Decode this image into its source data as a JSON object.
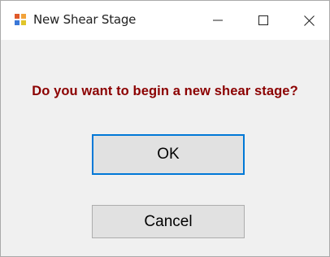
{
  "window": {
    "title": "New Shear Stage",
    "controls": {
      "minimize_icon": "minimize-icon",
      "maximize_icon": "maximize-icon",
      "close_icon": "close-icon"
    }
  },
  "dialog": {
    "message": "Do you want to begin a new shear stage?",
    "message_color": "#8b0000",
    "ok_label": "OK",
    "cancel_label": "Cancel",
    "focus_color": "#0078d7"
  }
}
